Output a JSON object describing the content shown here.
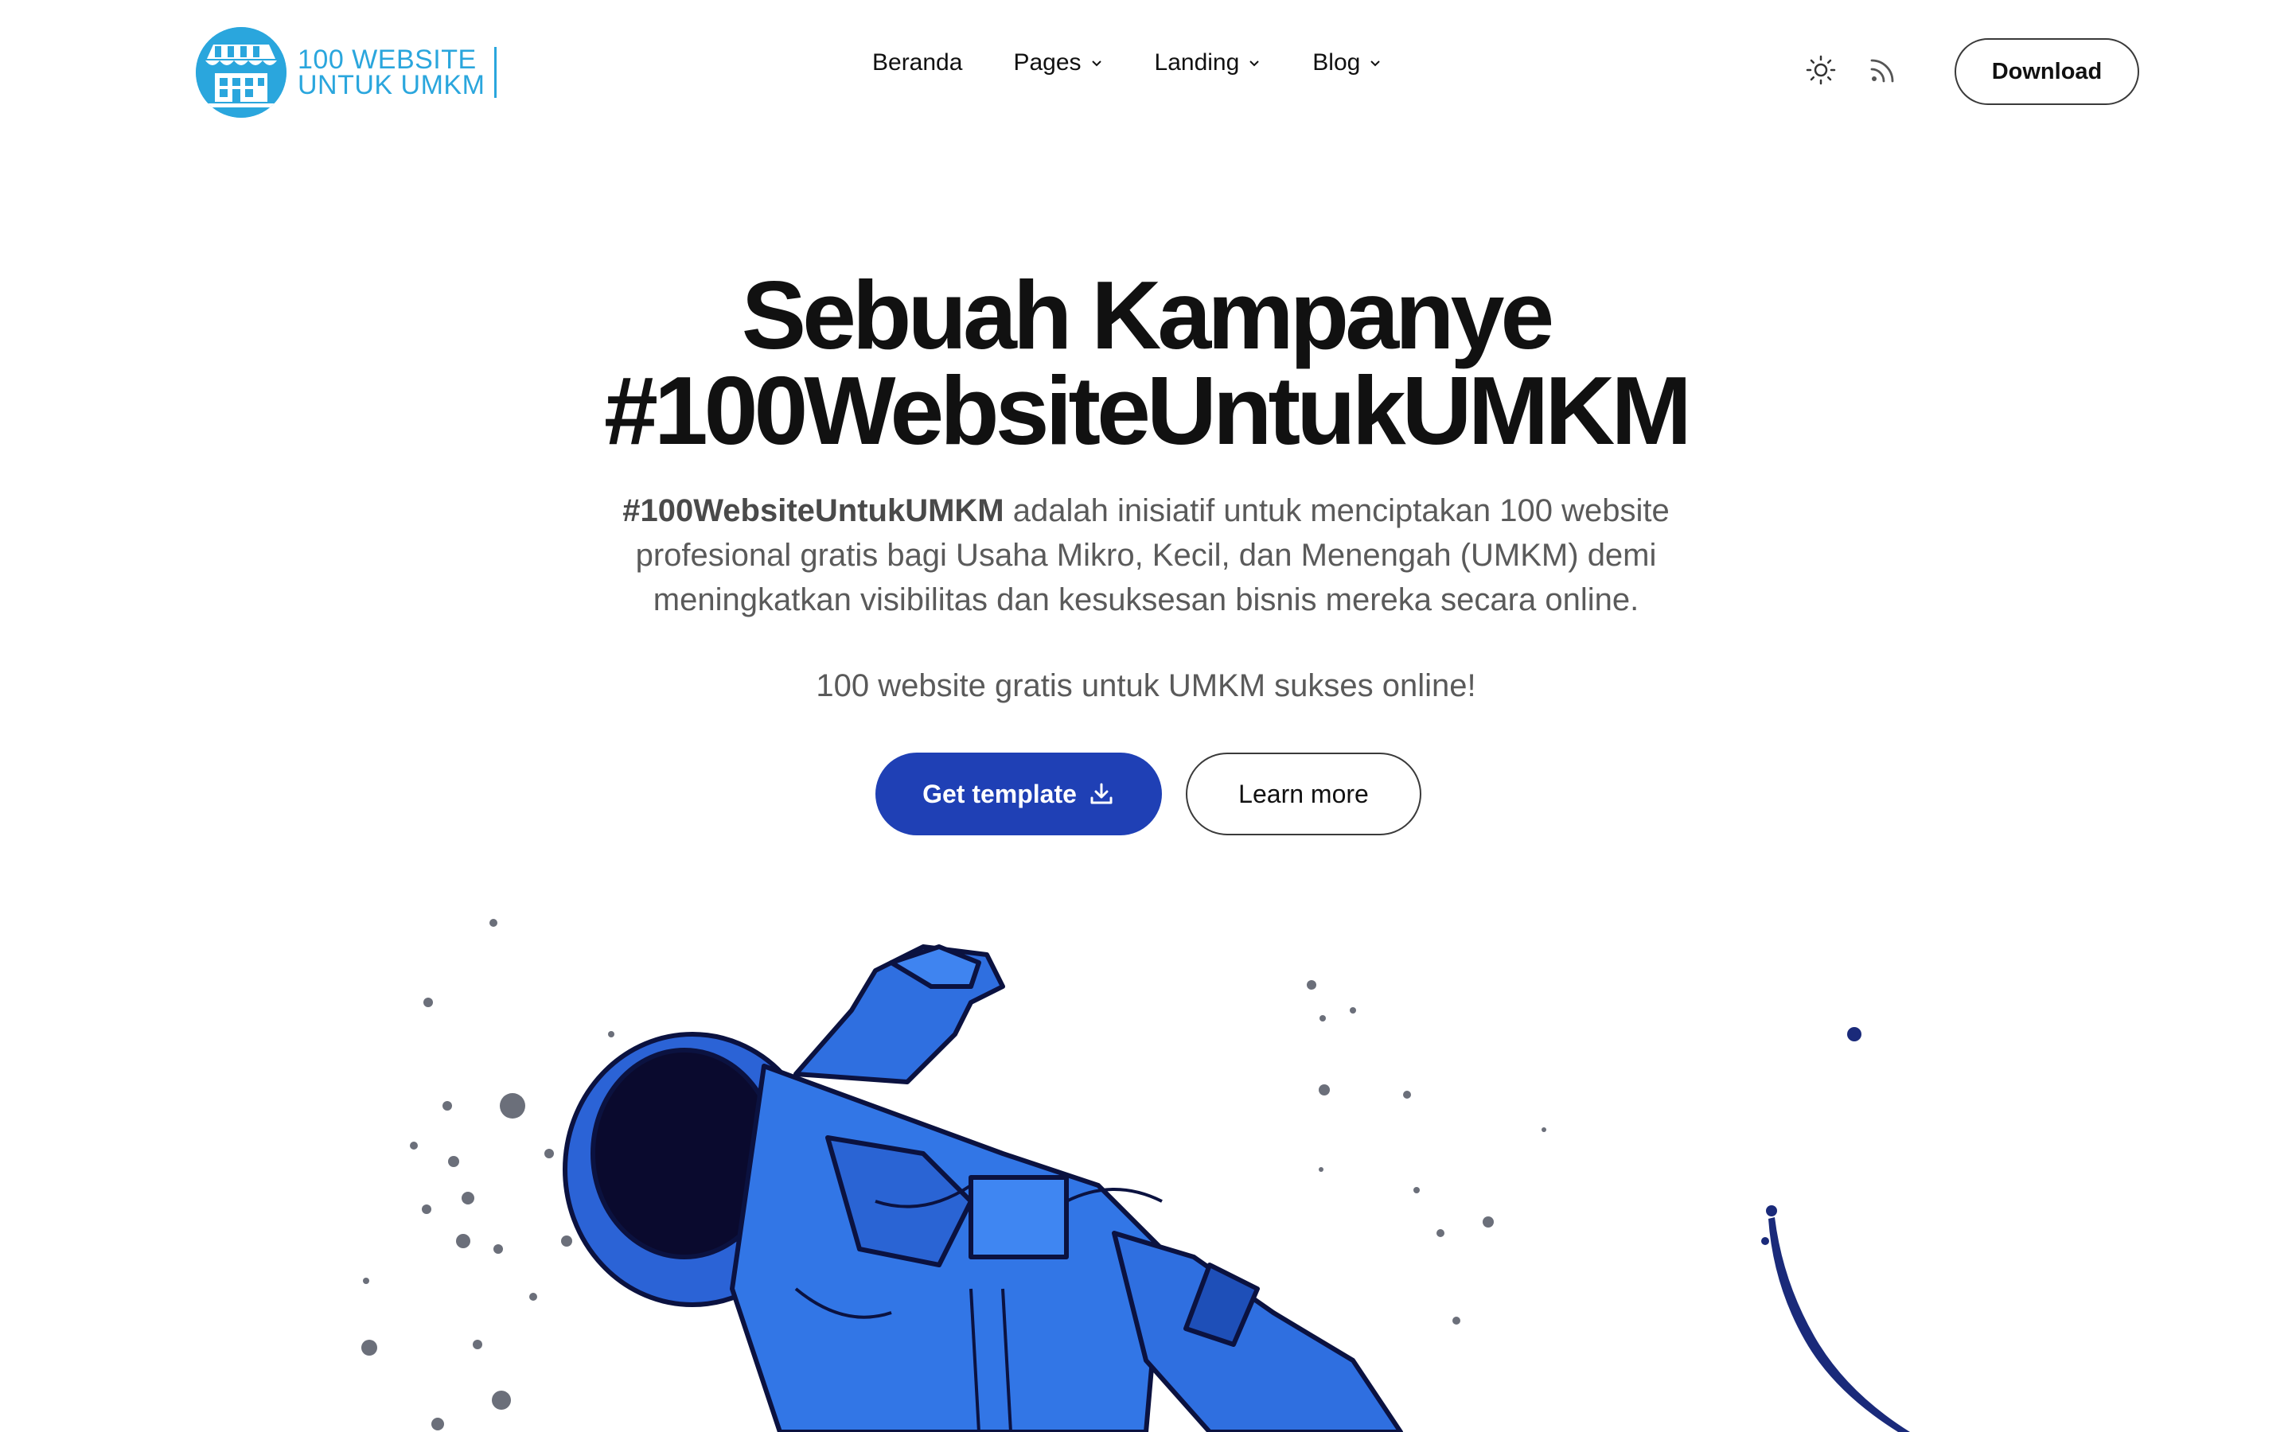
{
  "brand": {
    "line1": "100 WEBSITE",
    "line2": "UNTUK UMKM",
    "color": "#2aa6dd"
  },
  "nav": {
    "items": [
      {
        "label": "Beranda",
        "has_dropdown": false
      },
      {
        "label": "Pages",
        "has_dropdown": true
      },
      {
        "label": "Landing",
        "has_dropdown": true
      },
      {
        "label": "Blog",
        "has_dropdown": true
      }
    ]
  },
  "header": {
    "theme_icon": "sun-icon",
    "rss_icon": "rss-icon",
    "download_label": "Download"
  },
  "hero": {
    "title_line1": "Sebuah Kampanye",
    "title_line2": "#100WebsiteUntukUMKM",
    "desc_strong": "#100WebsiteUntukUMKM",
    "desc_rest": "adalah inisiatif untuk menciptakan 100 website profesional gratis bagi Usaha Mikro, Kecil, dan Menengah (UMKM) demi meningkatkan visibilitas dan kesuksesan bisnis mereka secara online.",
    "tagline": "100 website gratis untuk UMKM sukses online!",
    "primary_button": "Get template",
    "primary_button_icon": "download-icon",
    "secondary_button": "Learn more",
    "accent_color": "#1f40b5"
  }
}
